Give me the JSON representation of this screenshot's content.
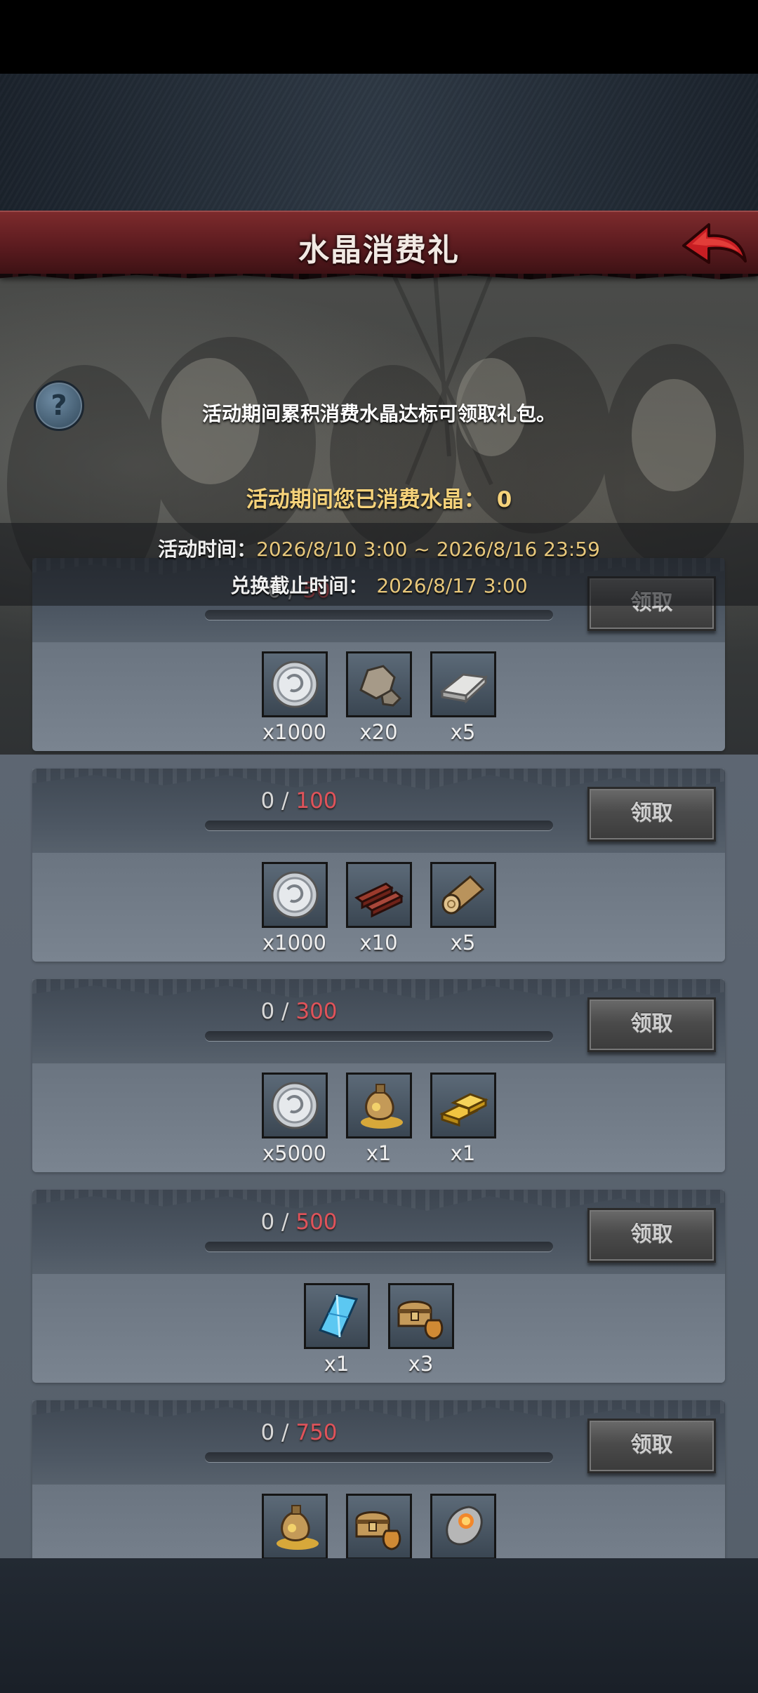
{
  "title": "水晶消费礼",
  "description": "活动期间累积消费水晶达标可领取礼包。",
  "spent": {
    "label": "活动期间您已消费水晶：",
    "value": "0"
  },
  "event_time": {
    "label": "活动时间：",
    "value": "2026/8/10 3:00 ~ 2026/8/16 23:59"
  },
  "exchange_deadline": {
    "label": "兑换截止时间：",
    "value": "2026/8/17 3:00"
  },
  "tiers": [
    {
      "current": "0",
      "target": "50",
      "progress": 0,
      "claim_label": "领取",
      "rewards": [
        {
          "icon": "silver-coin",
          "qty": "x1000"
        },
        {
          "icon": "stone",
          "qty": "x20"
        },
        {
          "icon": "iron-ingot",
          "qty": "x5"
        }
      ]
    },
    {
      "current": "0",
      "target": "100",
      "progress": 0,
      "claim_label": "领取",
      "rewards": [
        {
          "icon": "silver-coin",
          "qty": "x1000"
        },
        {
          "icon": "lumber-planks",
          "qty": "x10"
        },
        {
          "icon": "wood-log",
          "qty": "x5"
        }
      ]
    },
    {
      "current": "0",
      "target": "300",
      "progress": 0,
      "claim_label": "领取",
      "rewards": [
        {
          "icon": "silver-coin",
          "qty": "x5000"
        },
        {
          "icon": "gold-pouch",
          "qty": "x1"
        },
        {
          "icon": "gold-bars",
          "qty": "x1"
        }
      ]
    },
    {
      "current": "0",
      "target": "500",
      "progress": 0,
      "claim_label": "领取",
      "rewards": [
        {
          "icon": "blue-crystal",
          "qty": "x1"
        },
        {
          "icon": "treasure-chest",
          "qty": "x3"
        }
      ]
    },
    {
      "current": "0",
      "target": "750",
      "progress": 0,
      "claim_label": "领取",
      "rewards": [
        {
          "icon": "gold-pouch",
          "qty": ""
        },
        {
          "icon": "treasure-chest",
          "qty": ""
        },
        {
          "icon": "fire-stone",
          "qty": ""
        }
      ]
    }
  ],
  "colors": {
    "title_bar": "#5b1b1f",
    "target_value": "#e0535a",
    "gold_text": "#f5d27a"
  }
}
